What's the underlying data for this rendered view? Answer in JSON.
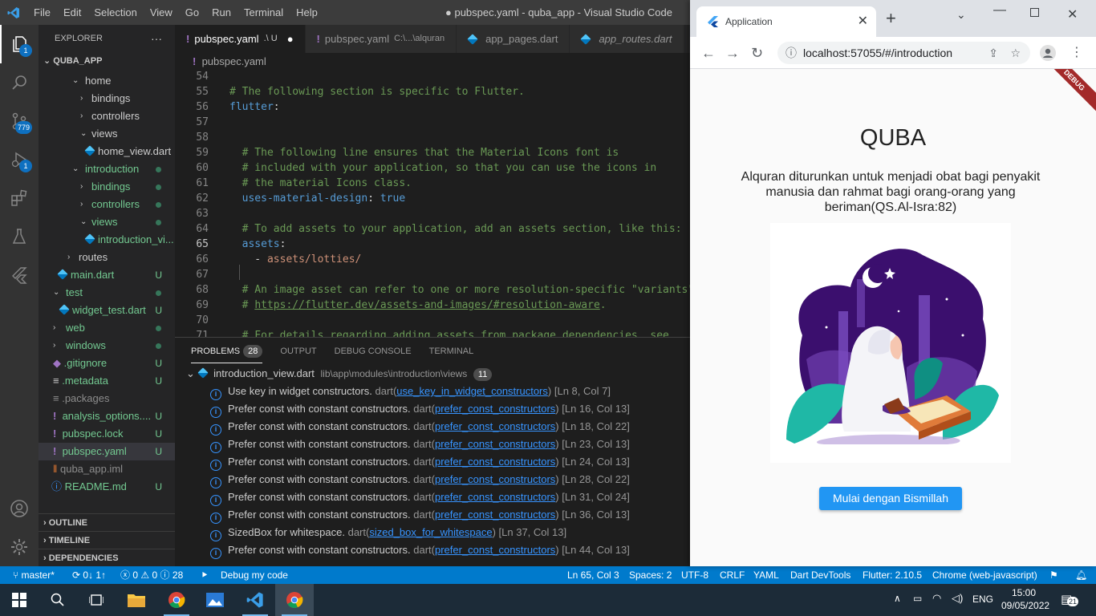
{
  "vscode": {
    "menu": [
      "File",
      "Edit",
      "Selection",
      "View",
      "Go",
      "Run",
      "Terminal",
      "Help"
    ],
    "window_title": "● pubspec.yaml - quba_app - Visual Studio Code",
    "activity_badges": {
      "explorer": "1",
      "scm": "779",
      "run": "1"
    },
    "sidebar": {
      "title": "EXPLORER",
      "more": "···",
      "root": "QUBA_APP",
      "tree": [
        {
          "label": "home",
          "status": ""
        },
        {
          "label": "bindings",
          "status": ""
        },
        {
          "label": "controllers",
          "status": ""
        },
        {
          "label": "views",
          "status": ""
        },
        {
          "label": "home_view.dart",
          "status": ""
        },
        {
          "label": "introduction",
          "status": "dot"
        },
        {
          "label": "bindings",
          "status": "dot"
        },
        {
          "label": "controllers",
          "status": "dot"
        },
        {
          "label": "views",
          "status": "dot"
        },
        {
          "label": "introduction_vi...",
          "status": "dot"
        },
        {
          "label": "routes",
          "status": ""
        },
        {
          "label": "main.dart",
          "status": "U"
        },
        {
          "label": "test",
          "status": "dot"
        },
        {
          "label": "widget_test.dart",
          "status": "U"
        },
        {
          "label": "web",
          "status": "dot"
        },
        {
          "label": "windows",
          "status": "dot"
        },
        {
          "label": ".gitignore",
          "status": "U"
        },
        {
          "label": ".metadata",
          "status": "U"
        },
        {
          "label": ".packages",
          "status": ""
        },
        {
          "label": "analysis_options....",
          "status": "U"
        },
        {
          "label": "pubspec.lock",
          "status": "U"
        },
        {
          "label": "pubspec.yaml",
          "status": "U"
        },
        {
          "label": "quba_app.iml",
          "status": ""
        },
        {
          "label": "README.md",
          "status": "U"
        }
      ],
      "sections": [
        "OUTLINE",
        "TIMELINE",
        "DEPENDENCIES"
      ]
    },
    "tabs": [
      {
        "label": "pubspec.yaml",
        "suffix": ".\\ U",
        "dirty": "●"
      },
      {
        "label": "pubspec.yaml",
        "suffix": "C:\\...\\alquran",
        "dirty": ""
      },
      {
        "label": "app_pages.dart",
        "suffix": "",
        "dirty": ""
      },
      {
        "label": "app_routes.dart",
        "suffix": "",
        "dirty": ""
      }
    ],
    "breadcrumb": "pubspec.yaml",
    "code_lines": [
      {
        "n": "54",
        "text": ""
      },
      {
        "n": "55",
        "text": "# The following section is specific to Flutter."
      },
      {
        "n": "56",
        "text": "flutter:"
      },
      {
        "n": "57",
        "text": ""
      },
      {
        "n": "58",
        "text": ""
      },
      {
        "n": "59",
        "text": "  # The following line ensures that the Material Icons font is"
      },
      {
        "n": "60",
        "text": "  # included with your application, so that you can use the icons in"
      },
      {
        "n": "61",
        "text": "  # the material Icons class."
      },
      {
        "n": "62",
        "text": "  uses-material-design: true"
      },
      {
        "n": "63",
        "text": ""
      },
      {
        "n": "64",
        "text": "  # To add assets to your application, add an assets section, like this:"
      },
      {
        "n": "65",
        "text": "  assets:"
      },
      {
        "n": "66",
        "text": "    - assets/lotties/"
      },
      {
        "n": "67",
        "text": ""
      },
      {
        "n": "68",
        "text": "  # An image asset can refer to one or more resolution-specific \"variants\","
      },
      {
        "n": "69",
        "text": "  # https://flutter.dev/assets-and-images/#resolution-aware."
      },
      {
        "n": "70",
        "text": ""
      },
      {
        "n": "71",
        "text": "  # For details regarding adding assets from package dependencies, see"
      }
    ],
    "panel": {
      "tabs": [
        "PROBLEMS",
        "OUTPUT",
        "DEBUG CONSOLE",
        "TERMINAL"
      ],
      "problems_count": "28",
      "file": "introduction_view.dart",
      "file_path": "lib\\app\\modules\\introduction\\views",
      "file_count": "11",
      "problems": [
        {
          "msg": "Use key in widget constructors.",
          "src": "dart",
          "rule": "use_key_in_widget_constructors",
          "pos": "[Ln 8, Col 7]"
        },
        {
          "msg": "Prefer const with constant constructors.",
          "src": "dart",
          "rule": "prefer_const_constructors",
          "pos": "[Ln 16, Col 13]"
        },
        {
          "msg": "Prefer const with constant constructors.",
          "src": "dart",
          "rule": "prefer_const_constructors",
          "pos": "[Ln 18, Col 22]"
        },
        {
          "msg": "Prefer const with constant constructors.",
          "src": "dart",
          "rule": "prefer_const_constructors",
          "pos": "[Ln 23, Col 13]"
        },
        {
          "msg": "Prefer const with constant constructors.",
          "src": "dart",
          "rule": "prefer_const_constructors",
          "pos": "[Ln 24, Col 13]"
        },
        {
          "msg": "Prefer const with constant constructors.",
          "src": "dart",
          "rule": "prefer_const_constructors",
          "pos": "[Ln 28, Col 22]"
        },
        {
          "msg": "Prefer const with constant constructors.",
          "src": "dart",
          "rule": "prefer_const_constructors",
          "pos": "[Ln 31, Col 24]"
        },
        {
          "msg": "Prefer const with constant constructors.",
          "src": "dart",
          "rule": "prefer_const_constructors",
          "pos": "[Ln 36, Col 13]"
        },
        {
          "msg": "SizedBox for whitespace.",
          "src": "dart",
          "rule": "sized_box_for_whitespace",
          "pos": "[Ln 37, Col 13]"
        },
        {
          "msg": "Prefer const with constant constructors.",
          "src": "dart",
          "rule": "prefer_const_constructors",
          "pos": "[Ln 44, Col 13]"
        }
      ]
    },
    "status": {
      "branch": "master*",
      "sync": "0↓ 1↑",
      "errors": "0",
      "warnings": "0",
      "infos": "28",
      "debug": "Debug my code",
      "cursor": "Ln 65, Col 3",
      "spaces": "Spaces: 2",
      "encoding": "UTF-8",
      "eol": "CRLF",
      "lang": "YAML",
      "devtools": "Dart DevTools",
      "flutter": "Flutter: 2.10.5",
      "device": "Chrome (web-javascript)"
    }
  },
  "browser": {
    "tab_title": "Application",
    "url": "localhost:57055/#/introduction",
    "debug_banner": "DEBUG",
    "app_title": "QUBA",
    "app_subtitle": "Alquran diturunkan untuk menjadi obat bagi penyakit manusia dan rahmat bagi orang-orang yang beriman(QS.Al-Isra:82)",
    "button": "Mulai dengan Bismillah"
  },
  "taskbar": {
    "lang": "ENG",
    "time": "15:00",
    "date": "09/05/2022",
    "notif": "21"
  },
  "colors": {
    "vscode_accent": "#007acc",
    "flutter_button": "#2196f3",
    "illustration_bg": "#3b0f6e"
  }
}
